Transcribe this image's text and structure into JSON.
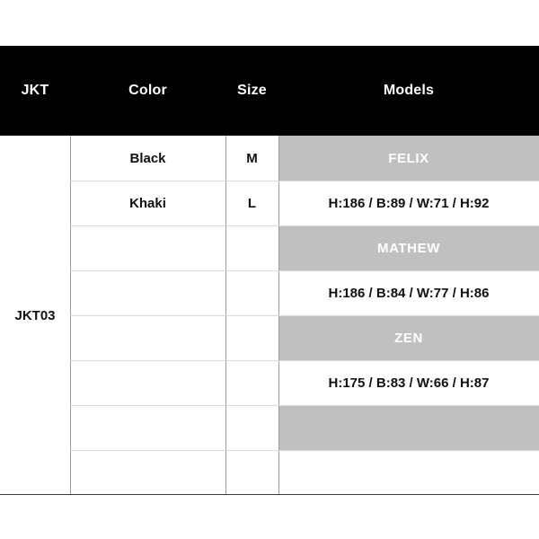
{
  "table": {
    "headers": {
      "jkt": "JKT",
      "color": "Color",
      "size": "Size",
      "models": "Models"
    },
    "product_code": "JKT03",
    "colors": [
      "Black",
      "Khaki",
      "",
      "",
      "",
      "",
      "",
      ""
    ],
    "sizes": [
      "M",
      "L",
      "",
      "",
      "",
      "",
      "",
      ""
    ],
    "models": [
      {
        "text": "FELIX",
        "style": "gray"
      },
      {
        "text": "H:186 / B:89 / W:71 / H:92",
        "style": "light"
      },
      {
        "text": "MATHEW",
        "style": "gray"
      },
      {
        "text": "H:186 / B:84 / W:77 / H:86",
        "style": "light"
      },
      {
        "text": "ZEN",
        "style": "gray"
      },
      {
        "text": "H:175 / B:83 / W:66 / H:87",
        "style": "light"
      },
      {
        "text": "",
        "style": "gray"
      },
      {
        "text": "",
        "style": "light"
      }
    ],
    "colors_hex": {
      "header_background": "#000000",
      "header_text": "#ffffff",
      "model_band": "#c0c0c0",
      "model_band_text": "#ffffff",
      "body_text": "#111111",
      "grid_line": "#d9d9d9",
      "column_line": "#9a9a9a",
      "outer_line": "#3a3a3a",
      "page_background": "#ffffff"
    }
  }
}
